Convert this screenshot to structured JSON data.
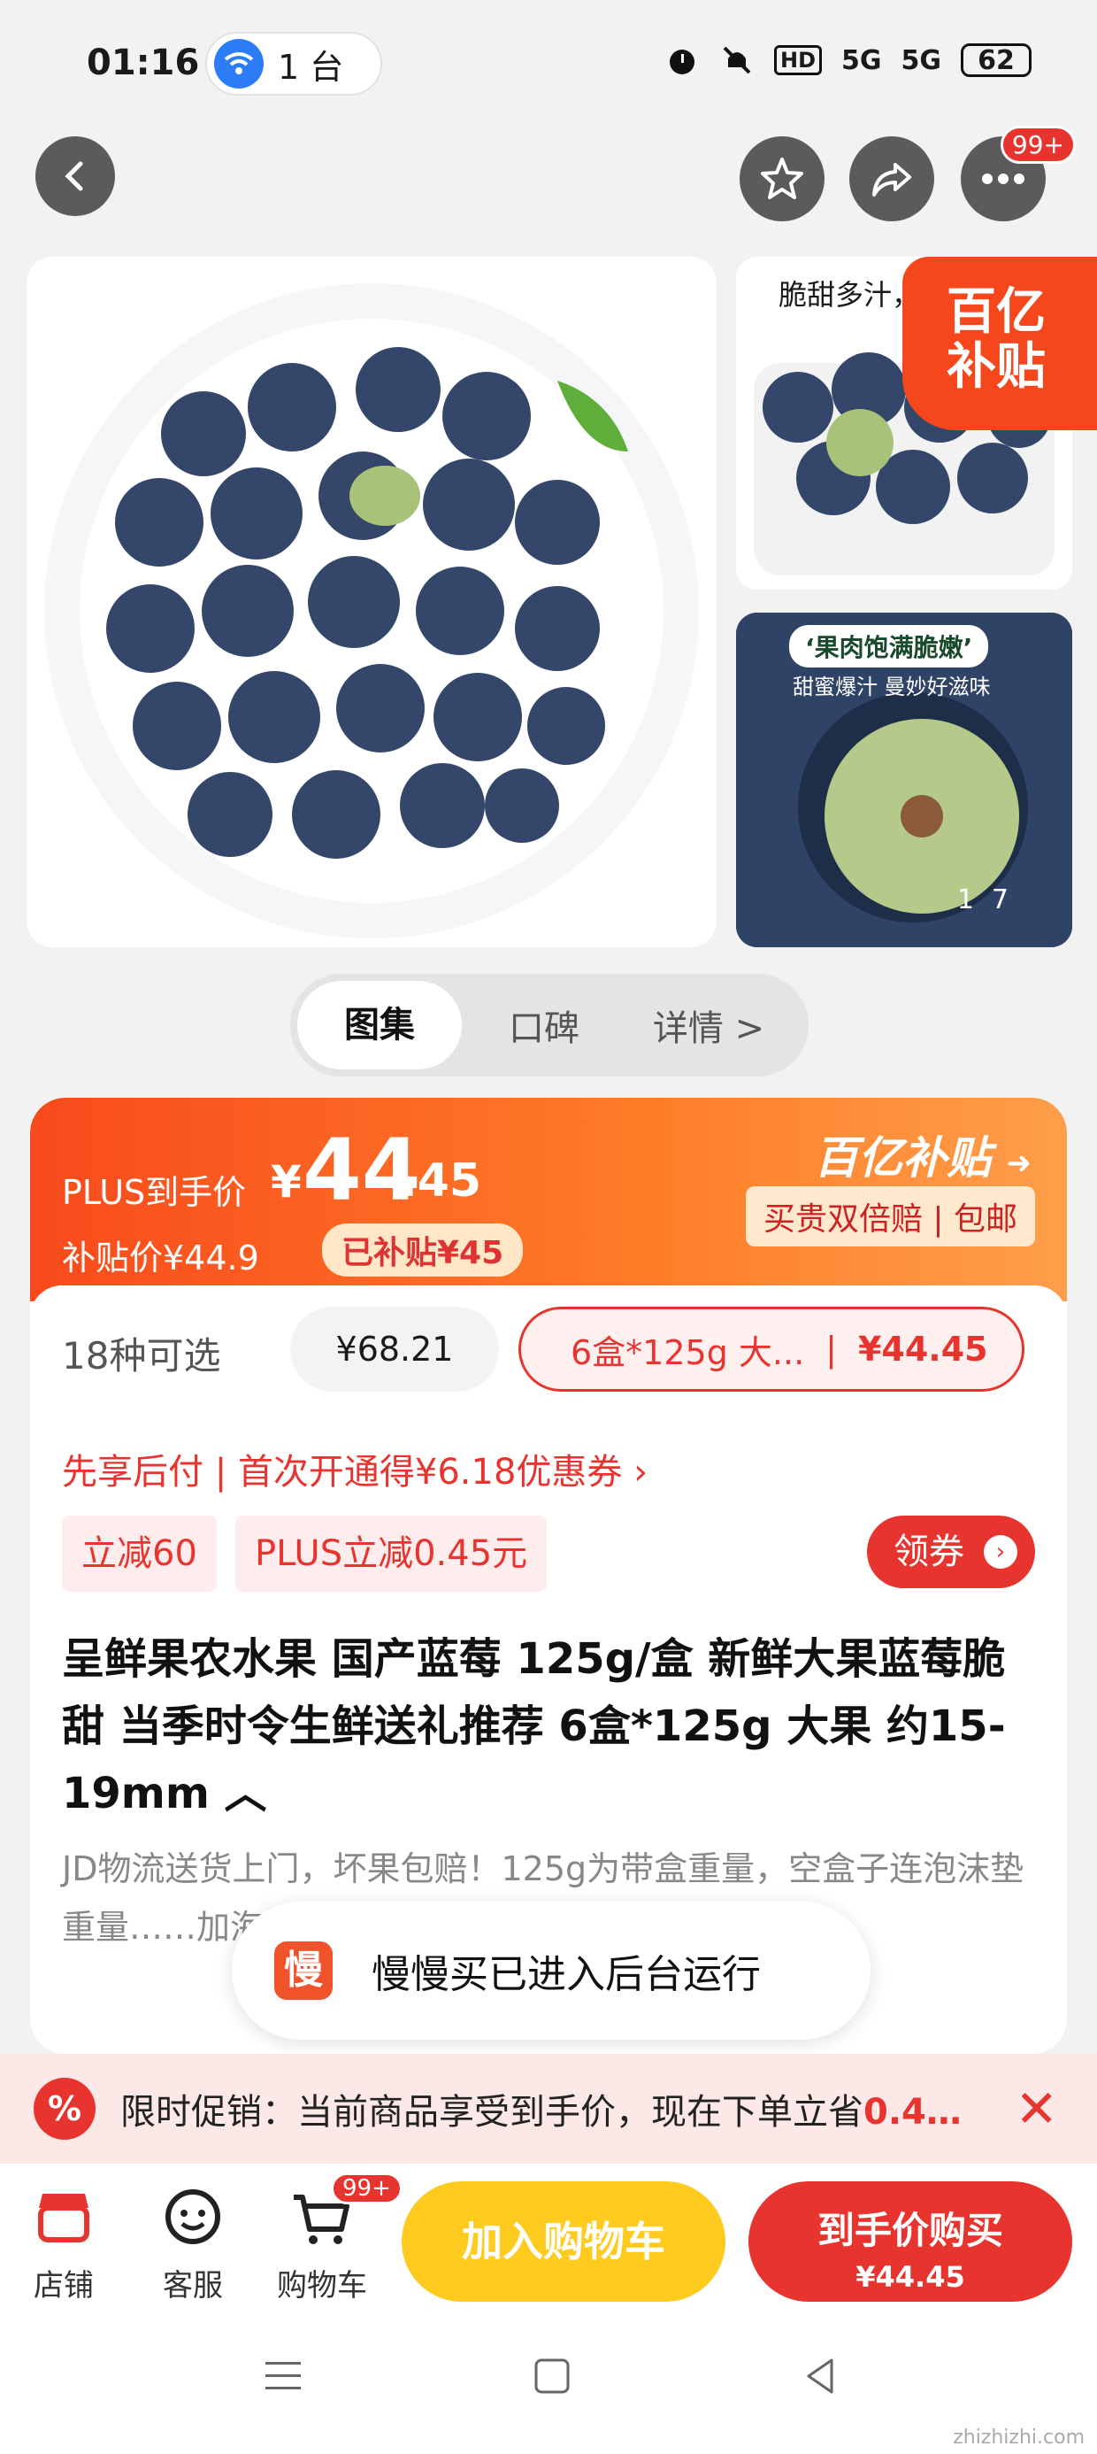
{
  "status": {
    "time": "01:16",
    "hotspot": "1 台",
    "hd": "HD",
    "net1": "5G",
    "net2": "5G",
    "battery": "62"
  },
  "topnav": {
    "badge": "99+"
  },
  "gallery": {
    "side1_caption": "脆甜多汁，",
    "subsidy_tag_line1": "百亿",
    "subsidy_tag_line2": "补贴",
    "side2_caption": "‘果肉饱满脆嫩’",
    "side2_subcaption": "甜蜜爆汁 曼妙好滋味",
    "counter_current": "1",
    "counter_total": "7"
  },
  "tabs": [
    {
      "label": "图集"
    },
    {
      "label": "口碑"
    },
    {
      "label": "详情 >"
    }
  ],
  "price": {
    "plus_label": "PLUS到手价",
    "yen": "¥",
    "integer": "44",
    "decimal": ".45",
    "subsidy_price": "补贴价¥44.9",
    "subsidized": "已补贴¥45",
    "brand": "百亿补贴",
    "guarantee": "买贵双倍赔 | 包邮"
  },
  "options": {
    "count": "18种可选",
    "chip_a": "¥68.21",
    "chip_b_label": "6盒*125g 大...",
    "chip_b_price": "¥44.45"
  },
  "paylater": "先享后付 | 首次开通得¥6.18优惠券 ›",
  "coupons": {
    "c1": "立减60",
    "c2": "PLUS立减0.45元",
    "get": "领券"
  },
  "product_title": "呈鲜果农水果 国产蓝莓 125g/盒 新鲜大果蓝莓脆甜 当季时令生鲜送礼推荐 6盒*125g 大果 约15-19mm ︿",
  "description": "JD物流送货上门，坏果包赔！125g为带盒重量，空盒子连泡沫垫重量……加海绵垫防止碰撞，破……",
  "toast": {
    "logo": "慢",
    "message": "慢慢买已进入后台运行"
  },
  "promo": {
    "icon": "%",
    "text_prefix": "限时促销：当前商品享受到手价，现在下单立省",
    "text_highlight": "0.4…",
    "close": "✕"
  },
  "bottombar": {
    "shop": "店铺",
    "service": "客服",
    "cart": "购物车",
    "cart_badge": "99+",
    "add_to_cart": "加入购物车",
    "buy_label": "到手价购买",
    "buy_price": "¥44.45"
  },
  "watermark": "zhizhizhi.com",
  "colors": {
    "accent_red": "#e8342f",
    "subsidy_orange": "#f84a1c",
    "cart_yellow": "#ffcb1f"
  }
}
